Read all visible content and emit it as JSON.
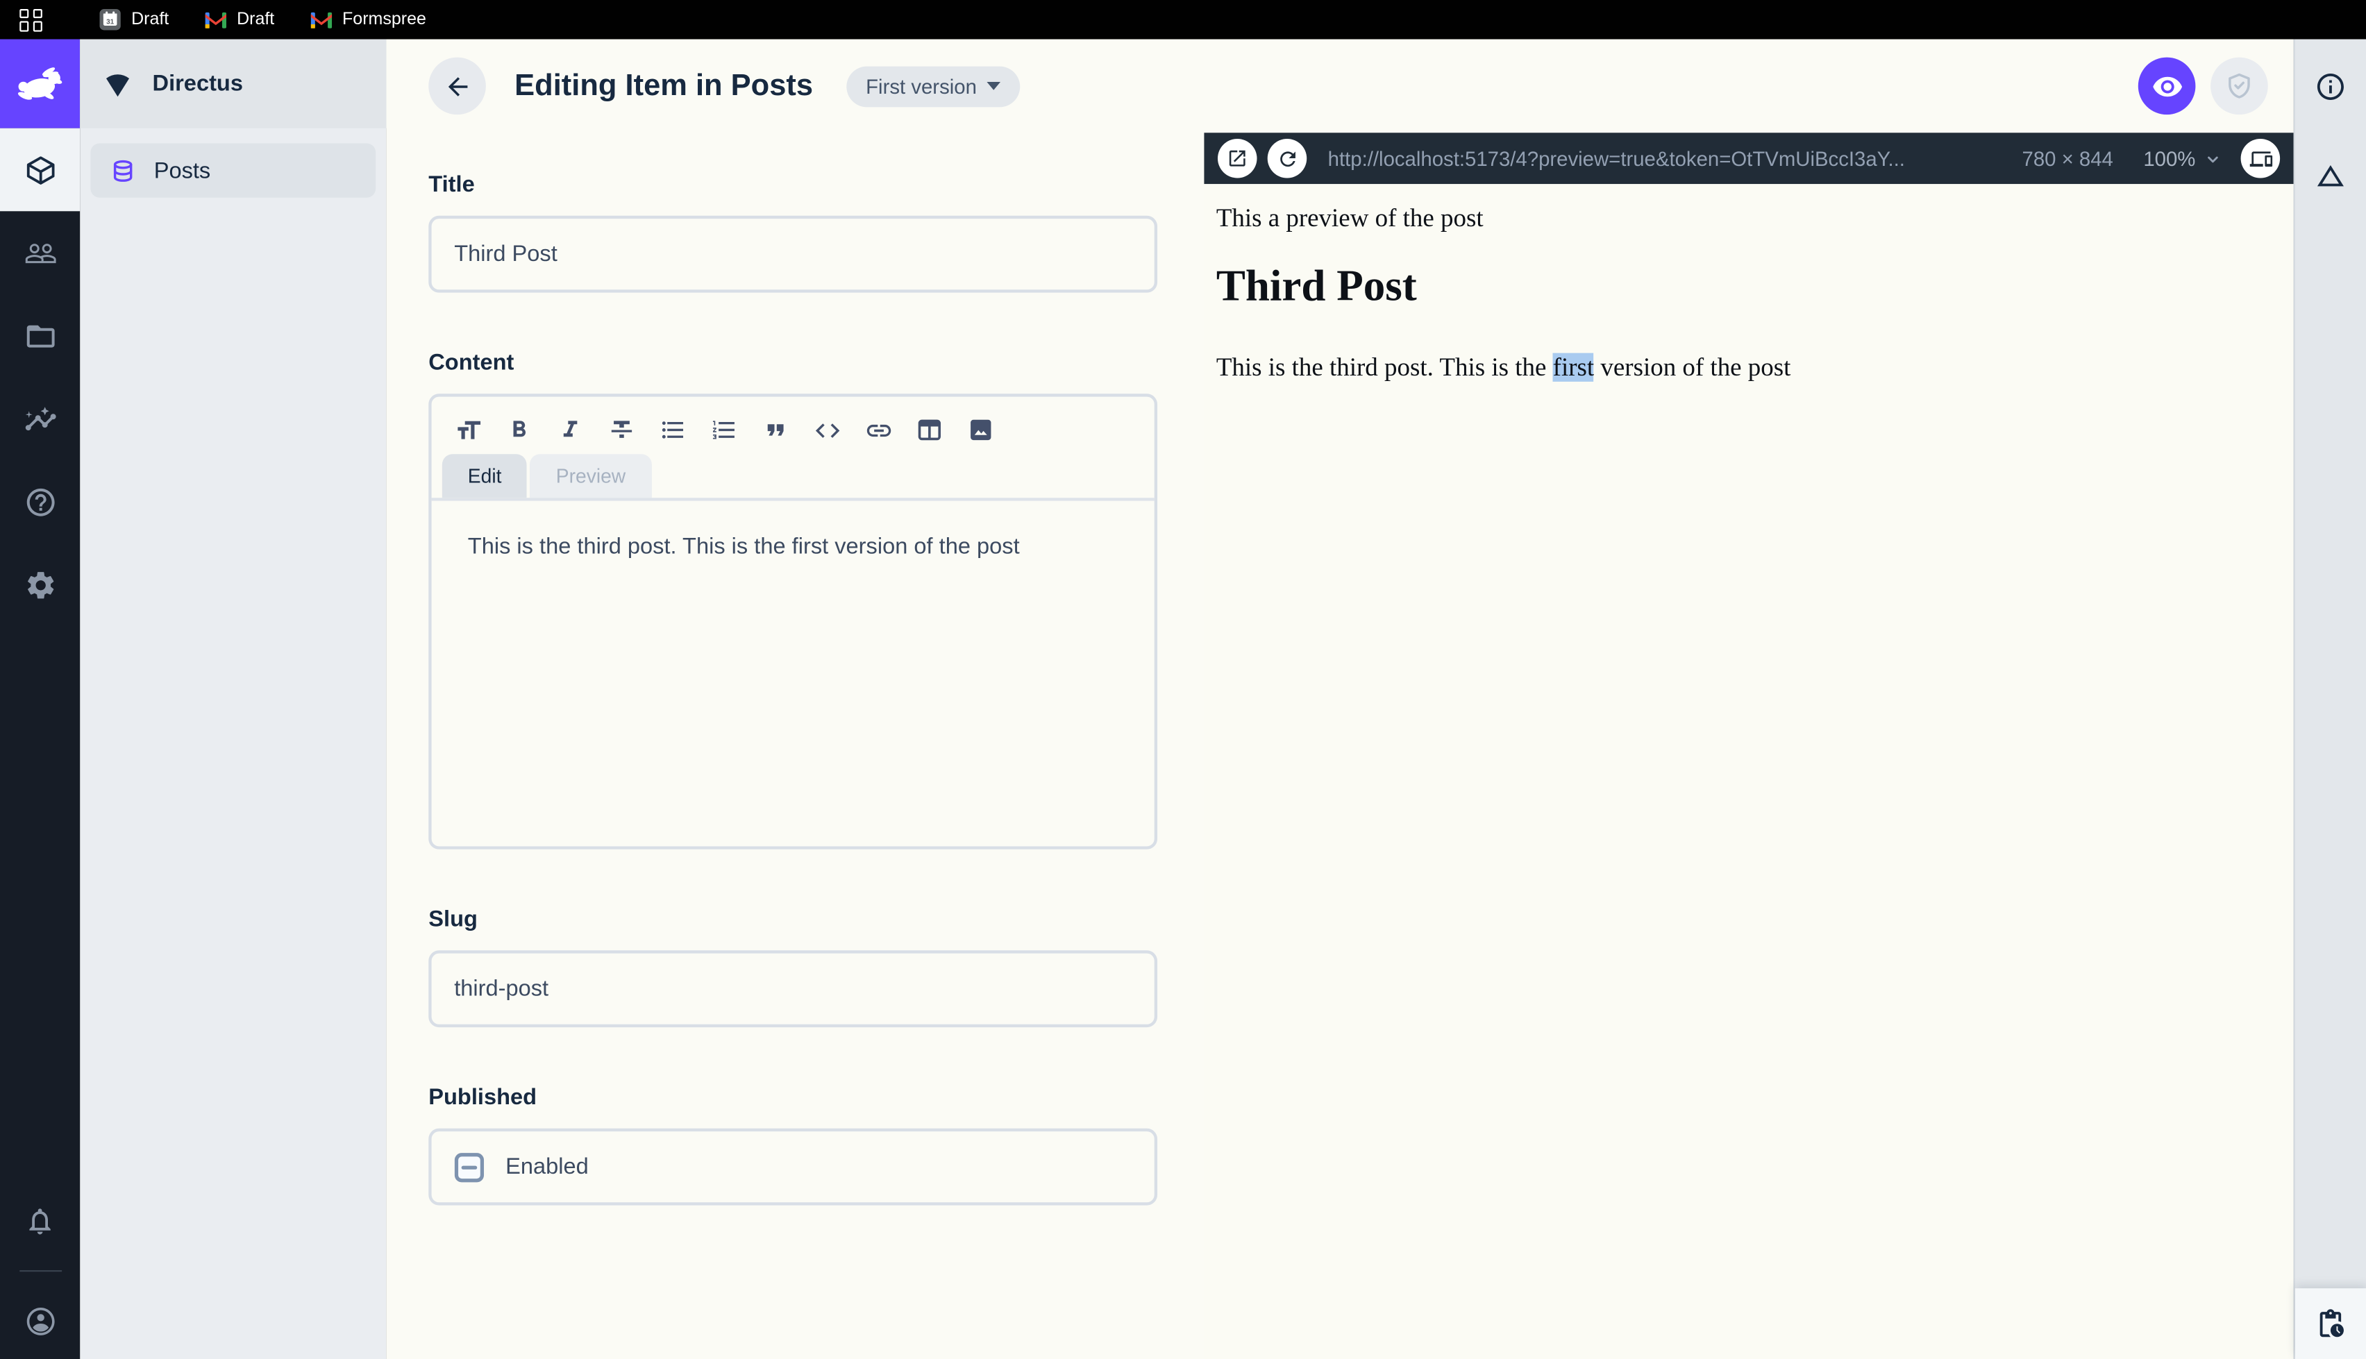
{
  "browser": {
    "tabs": [
      {
        "icon": "calendar-icon",
        "label": "Draft"
      },
      {
        "icon": "gmail-icon",
        "label": "Draft"
      },
      {
        "icon": "gmail-icon",
        "label": "Formspree"
      }
    ]
  },
  "module_bar": {
    "modules": [
      "content",
      "users",
      "files",
      "insights",
      "help",
      "settings"
    ],
    "bottom": [
      "notifications",
      "account"
    ]
  },
  "sidebar": {
    "project_name": "Directus",
    "items": [
      {
        "label": "Posts",
        "icon": "database-icon",
        "active": true
      }
    ]
  },
  "header": {
    "title": "Editing Item in Posts",
    "version_badge": "First version",
    "actions": [
      "live-preview",
      "permissions"
    ]
  },
  "form": {
    "title_field": {
      "label": "Title",
      "value": "Third Post"
    },
    "content_field": {
      "label": "Content",
      "toolbar_icons": [
        "heading",
        "bold",
        "italic",
        "strikethrough",
        "bullet-list",
        "numbered-list",
        "blockquote",
        "code",
        "link",
        "table",
        "image"
      ],
      "tabs": {
        "edit": "Edit",
        "preview": "Preview",
        "active": "Edit"
      },
      "value": "This is the third post. This is the first version of the post"
    },
    "slug_field": {
      "label": "Slug",
      "value": "third-post"
    },
    "published_field": {
      "label": "Published",
      "checkbox_label": "Enabled",
      "checkbox_state": "indeterminate"
    }
  },
  "preview": {
    "url": "http://localhost:5173/4?preview=true&token=OtTVmUiBccI3aY...",
    "dimensions": "780 × 844",
    "zoom_level": "100%",
    "document": {
      "intro": "This a preview of the post",
      "heading": "Third Post",
      "paragraph_before": "This is the third post. This is the ",
      "paragraph_highlight": "first",
      "paragraph_after": " version of the post"
    }
  },
  "colors": {
    "brand_purple": "#6644FF",
    "dark_navy": "#172940",
    "selection_highlight": "#A9CBF0",
    "preview_toolbar": "#212C37"
  }
}
